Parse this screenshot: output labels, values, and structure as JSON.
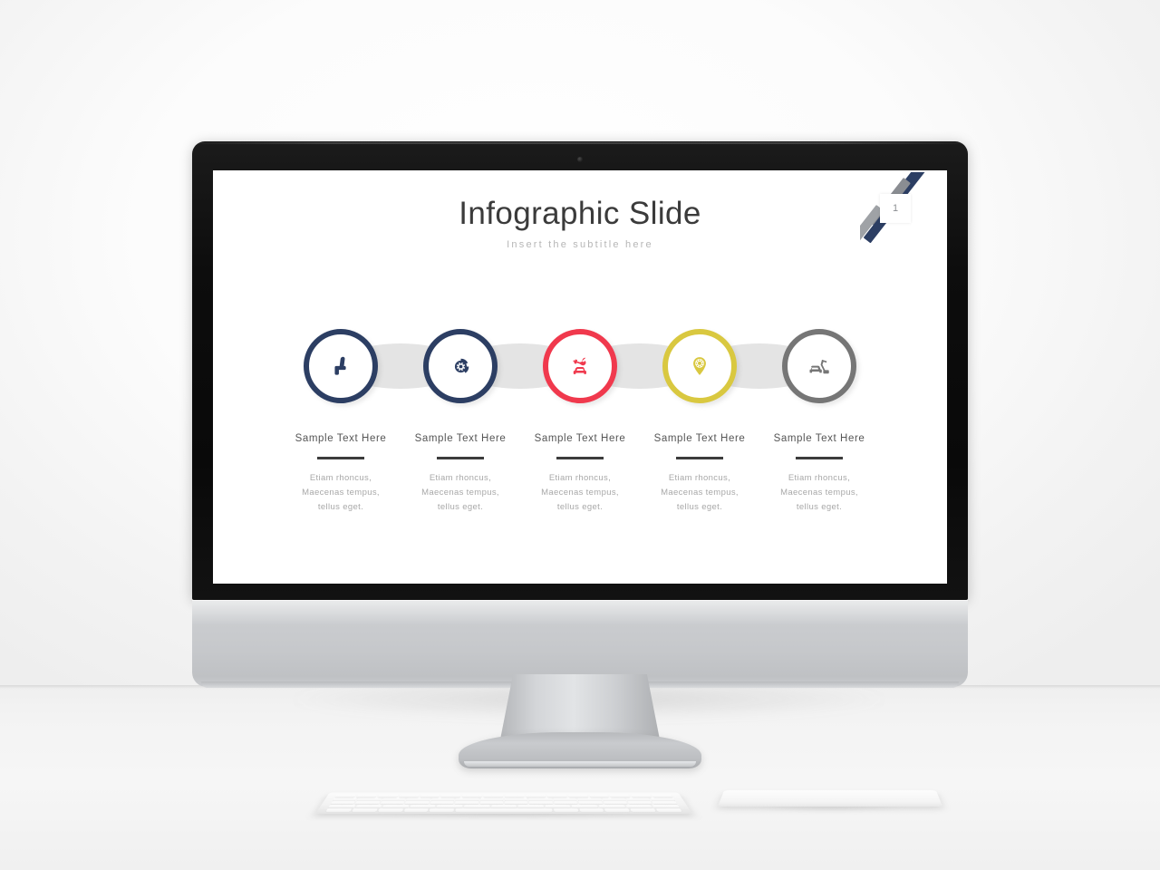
{
  "scene": {
    "device": "imac-desktop-monitor",
    "peripherals": [
      "keyboard",
      "trackpad"
    ]
  },
  "slide": {
    "title": "Infographic Slide",
    "subtitle": "Insert the subtitle here",
    "corner": {
      "number": "1",
      "stripe_navy": "#2c3e63",
      "stripe_gray": "#8a8d92"
    },
    "connector_color": "#e4e4e4",
    "nodes": [
      {
        "icon": "car-seat-icon",
        "color": "#2c3e63",
        "title": "Sample  Text Here",
        "body_line_1": "Etiam  rhoncus,",
        "body_line_2": "Maecenas  tempus,",
        "body_line_3": "tellus  eget."
      },
      {
        "icon": "brake-disc-icon",
        "color": "#2c3e63",
        "title": "Sample  Text Here",
        "body_line_1": "Etiam  rhoncus,",
        "body_line_2": "Maecenas  tempus,",
        "body_line_3": "tellus  eget."
      },
      {
        "icon": "car-repair-wrench-icon",
        "color": "#f0394d",
        "title": "Sample  Text Here",
        "body_line_1": "Etiam  rhoncus,",
        "body_line_2": "Maecenas  tempus,",
        "body_line_3": "tellus  eget."
      },
      {
        "icon": "location-pin-gear-icon",
        "color": "#d9c840",
        "title": "Sample  Text Here",
        "body_line_1": "Etiam  rhoncus,",
        "body_line_2": "Maecenas  tempus,",
        "body_line_3": "tellus  eget."
      },
      {
        "icon": "car-service-arm-icon",
        "color": "#767676",
        "title": "Sample  Text Here",
        "body_line_1": "Etiam  rhoncus,",
        "body_line_2": "Maecenas  tempus,",
        "body_line_3": "tellus  eget."
      }
    ]
  }
}
